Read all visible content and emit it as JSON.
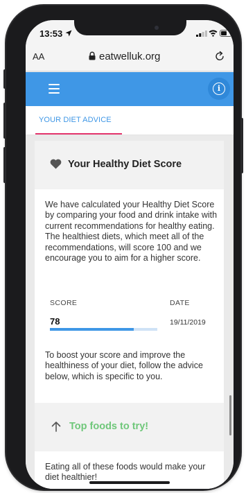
{
  "status_bar": {
    "time": "13:53"
  },
  "browser": {
    "text_size_label": "AA",
    "url": "eatwelluk.org"
  },
  "tabs": [
    {
      "label": "YOUR DIET ADVICE",
      "active": true
    }
  ],
  "score_card": {
    "title": "Your Healthy Diet Score",
    "description": "We have calculated your Healthy Diet Score by comparing your food and drink intake with current recommendations for healthy eating. The healthiest diets, which meet all of the recommendations, will score 100 and we encourage you to aim for a higher score.",
    "score_label": "SCORE",
    "date_label": "DATE",
    "score_value": "78",
    "score_fraction": 0.78,
    "date_value": "19/11/2019",
    "boost_text": "To boost your score and improve the healthiness of your diet, follow the advice below, which is specific to you."
  },
  "foods_section": {
    "title": "Top foods to try!",
    "text": "Eating all of these foods would make your diet healthier!"
  },
  "colors": {
    "nav_blue": "#3f97e6",
    "tab_underline": "#e3346c",
    "foods_green": "#6fc77a",
    "score_track": "#cfe2f6"
  },
  "icons": [
    "location-arrow-icon",
    "signal-icon",
    "wifi-icon",
    "battery-icon",
    "lock-icon",
    "reload-icon",
    "hamburger-menu-icon",
    "info-icon",
    "heart-icon",
    "arrow-up-icon"
  ]
}
